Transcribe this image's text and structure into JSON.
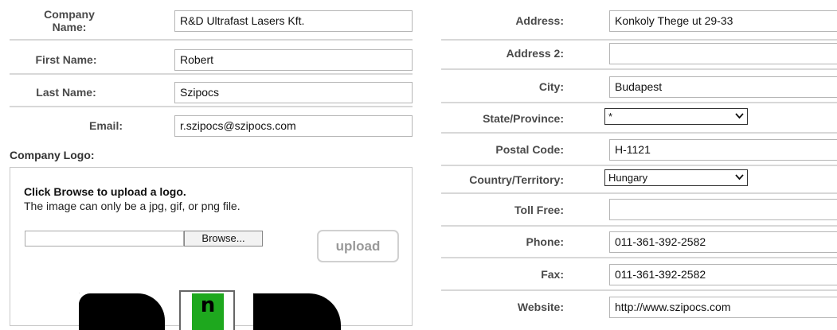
{
  "left": {
    "company_name": {
      "label": "Company Name:",
      "value": "R&D Ultrafast Lasers Kft."
    },
    "first_name": {
      "label": "First Name:",
      "value": "Robert"
    },
    "last_name": {
      "label": "Last Name:",
      "value": "Szipocs"
    },
    "email": {
      "label": "Email:",
      "value": "r.szipocs@szipocs.com"
    },
    "logo_section": {
      "heading": "Company Logo:",
      "instruction_bold": "Click Browse to upload a logo.",
      "instruction": "The image can only be a jpg, gif, or png file.",
      "file_value": "",
      "browse_label": "Browse...",
      "upload_label": "upload",
      "logo_letters": {
        "left": "R",
        "middle": "n",
        "right": "D"
      }
    }
  },
  "right": {
    "address": {
      "label": "Address:",
      "value": "Konkoly Thege ut 29-33"
    },
    "address2": {
      "label": "Address 2:",
      "value": ""
    },
    "city": {
      "label": "City:",
      "value": "Budapest"
    },
    "state": {
      "label": "State/Province:",
      "value": "*"
    },
    "postal": {
      "label": "Postal Code:",
      "value": "H-1121"
    },
    "country": {
      "label": "Country/Territory:",
      "value": "Hungary"
    },
    "toll_free": {
      "label": "Toll Free:",
      "value": ""
    },
    "phone": {
      "label": "Phone:",
      "value": "011-361-392-2582"
    },
    "fax": {
      "label": "Fax:",
      "value": "011-361-392-2582"
    },
    "website": {
      "label": "Website:",
      "value": "http://www.szipocs.com"
    }
  },
  "colors": {
    "separator": "#d8d8d8",
    "label": "#4a4a4a",
    "border": "#b5b5b5"
  }
}
